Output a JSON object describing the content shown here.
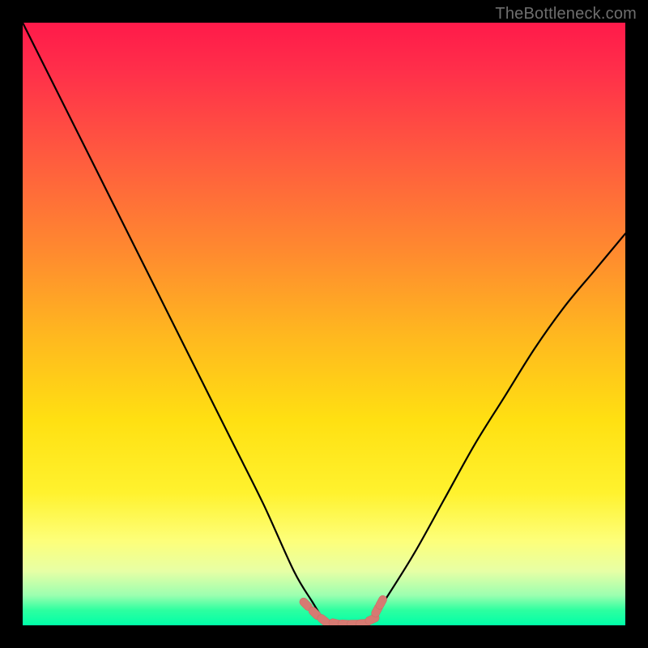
{
  "watermark": {
    "text": "TheBottleneck.com"
  },
  "colors": {
    "curve_stroke": "#000000",
    "marker_fill": "#d67a72",
    "marker_stroke": "#c96a63",
    "frame_bg": "#000000"
  },
  "chart_data": {
    "type": "line",
    "title": "",
    "xlabel": "",
    "ylabel": "",
    "xlim": [
      0,
      100
    ],
    "ylim": [
      0,
      100
    ],
    "grid": false,
    "legend": false,
    "series": [
      {
        "name": "bottleneck-curve",
        "x": [
          0,
          5,
          10,
          15,
          20,
          25,
          30,
          35,
          40,
          45,
          48,
          50,
          52,
          54,
          56,
          58,
          60,
          65,
          70,
          75,
          80,
          85,
          90,
          95,
          100
        ],
        "y": [
          100,
          90,
          80,
          70,
          60,
          50,
          40,
          30,
          20,
          9,
          4,
          1,
          0,
          0,
          0,
          1,
          4,
          12,
          21,
          30,
          38,
          46,
          53,
          59,
          65
        ]
      }
    ],
    "markers": {
      "name": "highlight-points",
      "x": [
        47.0,
        48.5,
        50.0,
        52.0,
        53.5,
        55.0,
        56.5,
        58.0,
        58.8,
        59.5
      ],
      "y": [
        3.5,
        2.0,
        0.8,
        0.3,
        0.2,
        0.2,
        0.3,
        1.0,
        2.5,
        3.8
      ]
    }
  }
}
